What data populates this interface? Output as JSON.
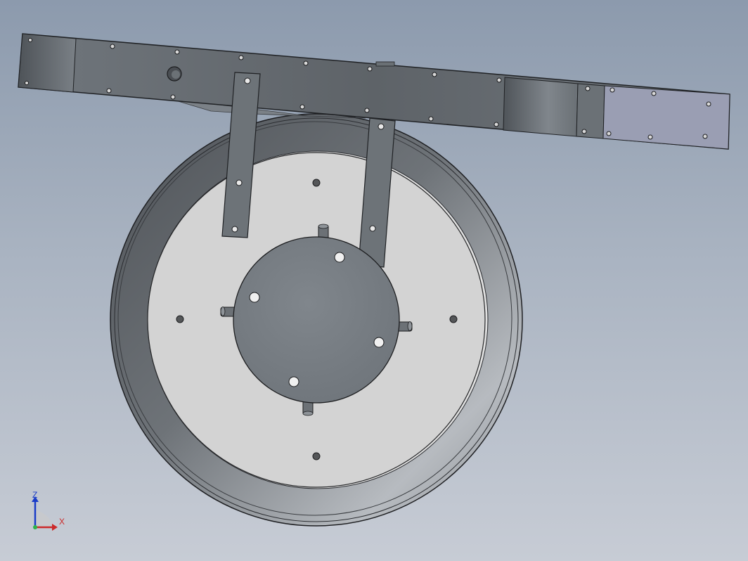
{
  "view": {
    "background_top": "#8c9aad",
    "background_bottom": "#c7ccd5"
  },
  "model": {
    "parts": [
      "frame-beam-icon",
      "mounting-bracket-icon",
      "wheel-rim-icon",
      "wheel-disc-icon",
      "hub-plate-icon",
      "hub-pin-icon",
      "end-plate-icon"
    ],
    "colors": {
      "beam": "#5f6469",
      "beam_light": "#7e858c",
      "end_plate": "#9a9eb4",
      "rim_dark": "#55595e",
      "rim_light": "#aeb2b7",
      "disc": "#d4d4d4",
      "hub": "#777d83",
      "hole": "#f2f2f2"
    }
  },
  "triad": {
    "z_label": "Z",
    "x_label": "X",
    "z_color": "#1a3cc8",
    "x_color": "#cc2a2a"
  }
}
